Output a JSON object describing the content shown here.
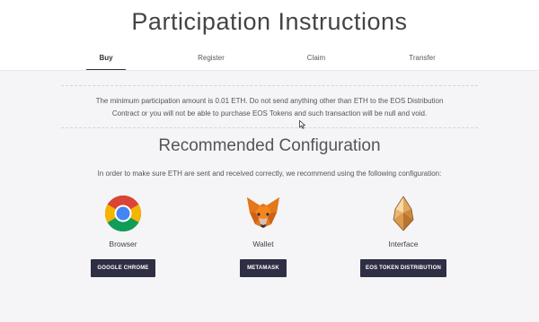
{
  "page": {
    "title": "Participation Instructions"
  },
  "tabs": [
    {
      "label": "Buy",
      "active": true
    },
    {
      "label": "Register",
      "active": false
    },
    {
      "label": "Claim",
      "active": false
    },
    {
      "label": "Transfer",
      "active": false
    }
  ],
  "notice": {
    "line1": "The minimum participation amount is 0.01 ETH. Do not send anything other than ETH to the EOS Distribution",
    "line2": "Contract or you will not be able to purchase EOS Tokens and such transaction will be null and void."
  },
  "config": {
    "title": "Recommended Configuration",
    "intro": "In order to make sure ETH are sent and received correctly, we recommend using the following configuration:",
    "items": [
      {
        "icon": "chrome-icon",
        "label": "Browser",
        "button": "GOOGLE CHROME"
      },
      {
        "icon": "metamask-fox-icon",
        "label": "Wallet",
        "button": "METAMASK"
      },
      {
        "icon": "eos-logo-icon",
        "label": "Interface",
        "button": "EOS TOKEN DISTRIBUTION"
      }
    ]
  },
  "colors": {
    "button_bg": "#2e2f44",
    "content_bg": "#f5f5f7"
  }
}
